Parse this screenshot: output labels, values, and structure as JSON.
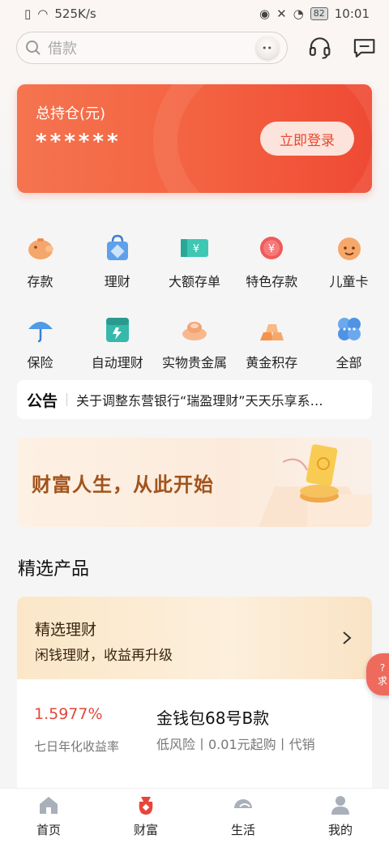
{
  "status": {
    "speed": "525K/s",
    "battery": "82",
    "time": "10:01"
  },
  "search": {
    "placeholder": "借款"
  },
  "asset": {
    "title": "总持仓(元)",
    "masked_value": "******",
    "login_label": "立即登录"
  },
  "grid": [
    [
      {
        "label": "存款",
        "icon": "piggy-bank-icon"
      },
      {
        "label": "理财",
        "icon": "bag-icon"
      },
      {
        "label": "大额存单",
        "icon": "certificate-icon"
      },
      {
        "label": "特色存款",
        "icon": "yen-coin-icon"
      },
      {
        "label": "儿童卡",
        "icon": "child-face-icon"
      }
    ],
    [
      {
        "label": "保险",
        "icon": "umbrella-icon"
      },
      {
        "label": "自动理财",
        "icon": "auto-finance-icon"
      },
      {
        "label": "实物贵金属",
        "icon": "gold-ingot-icon"
      },
      {
        "label": "黄金积存",
        "icon": "gold-bars-icon"
      },
      {
        "label": "全部",
        "icon": "all-icon"
      }
    ]
  ],
  "notice": {
    "tag": "公告",
    "text": "关于调整东营银行“瑞盈理财”天天乐享系…"
  },
  "banner": {
    "text": "财富人生，从此开始"
  },
  "section": {
    "title": "精选产品"
  },
  "product": {
    "header_title": "精选理财",
    "header_sub": "闲钱理财，收益再升级",
    "rate": "1.5977%",
    "rate_label": "七日年化收益率",
    "name": "金钱包68号B款",
    "desc": "低风险丨0.01元起购丨代销"
  },
  "float_label": "求",
  "tabs": [
    {
      "label": "首页",
      "icon": "home-icon"
    },
    {
      "label": "财富",
      "icon": "wealth-bag-icon"
    },
    {
      "label": "生活",
      "icon": "life-icon"
    },
    {
      "label": "我的",
      "icon": "profile-icon"
    }
  ],
  "colors": {
    "accent": "#f36140",
    "gold_text": "#a2531c",
    "rate": "#e04a3a"
  }
}
